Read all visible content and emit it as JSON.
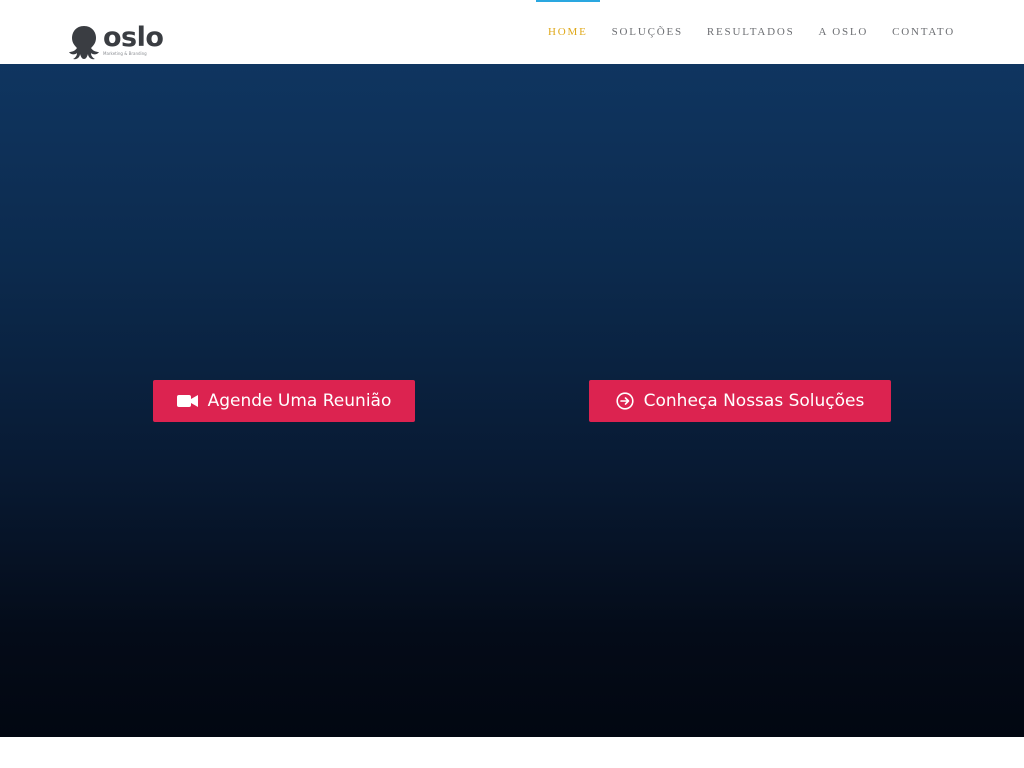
{
  "brand": {
    "name": "oslo",
    "tagline": "Marketing & Branding"
  },
  "nav": {
    "items": [
      {
        "label": "HOME",
        "active": true
      },
      {
        "label": "SOLUÇÕES",
        "active": false
      },
      {
        "label": "RESULTADOS",
        "active": false
      },
      {
        "label": "A OSLO",
        "active": false
      },
      {
        "label": "CONTATO",
        "active": false
      }
    ]
  },
  "hero": {
    "primary_cta": {
      "label": "Agende Uma Reunião",
      "icon": "video-camera-icon"
    },
    "secondary_cta": {
      "label": "Conheça Nossas Soluções",
      "icon": "arrow-circle-right-icon"
    }
  },
  "colors": {
    "accent_cta": "#dc2350",
    "nav_active": "#e0a91b",
    "nav_indicator": "#2aa7e0",
    "hero_top": "#0f3560",
    "hero_bottom": "#020711",
    "logo": "#3a3d42"
  }
}
